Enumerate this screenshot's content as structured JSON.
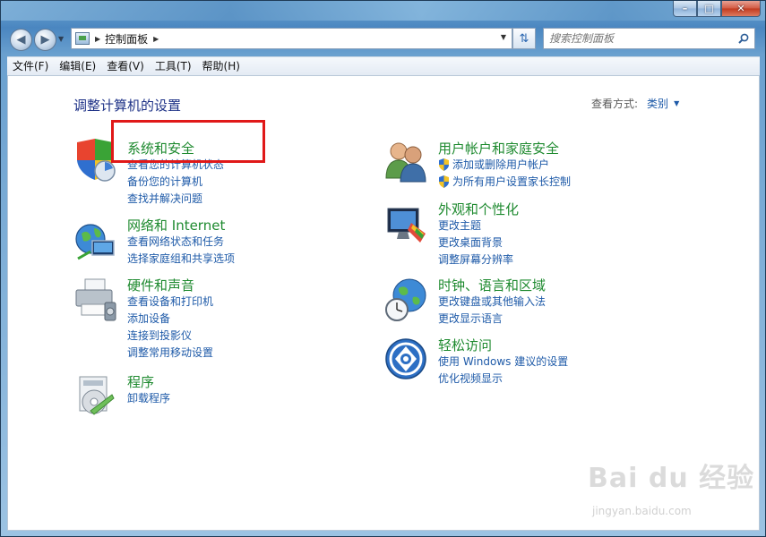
{
  "address": {
    "path": "控制面板"
  },
  "search": {
    "placeholder": "搜索控制面板"
  },
  "menu": [
    "文件(F)",
    "编辑(E)",
    "查看(V)",
    "工具(T)",
    "帮助(H)"
  ],
  "page": {
    "heading": "调整计算机的设置",
    "view_by_label": "查看方式:",
    "view_by_value": "类别"
  },
  "categories": {
    "system_security": {
      "title": "系统和安全",
      "links": [
        "查看您的计算机状态",
        "备份您的计算机",
        "查找并解决问题"
      ]
    },
    "network": {
      "title": "网络和 Internet",
      "links": [
        "查看网络状态和任务",
        "选择家庭组和共享选项"
      ]
    },
    "hardware": {
      "title": "硬件和声音",
      "links": [
        "查看设备和打印机",
        "添加设备",
        "连接到投影仪",
        "调整常用移动设置"
      ]
    },
    "programs": {
      "title": "程序",
      "links": [
        "卸载程序"
      ]
    },
    "user_accounts": {
      "title": "用户帐户和家庭安全",
      "links": [
        "添加或删除用户帐户",
        "为所有用户设置家长控制"
      ]
    },
    "appearance": {
      "title": "外观和个性化",
      "links": [
        "更改主题",
        "更改桌面背景",
        "调整屏幕分辨率"
      ]
    },
    "clock": {
      "title": "时钟、语言和区域",
      "links": [
        "更改键盘或其他输入法",
        "更改显示语言"
      ]
    },
    "ease": {
      "title": "轻松访问",
      "links": [
        "使用 Windows 建议的设置",
        "优化视频显示"
      ]
    }
  },
  "watermark": {
    "brand": "Bai du 经验",
    "url": "jingyan.baidu.com"
  },
  "colors": {
    "link": "#1e5aa8",
    "category_title": "#1e8a2f",
    "heading": "#1e3287",
    "highlight": "#e01818"
  }
}
